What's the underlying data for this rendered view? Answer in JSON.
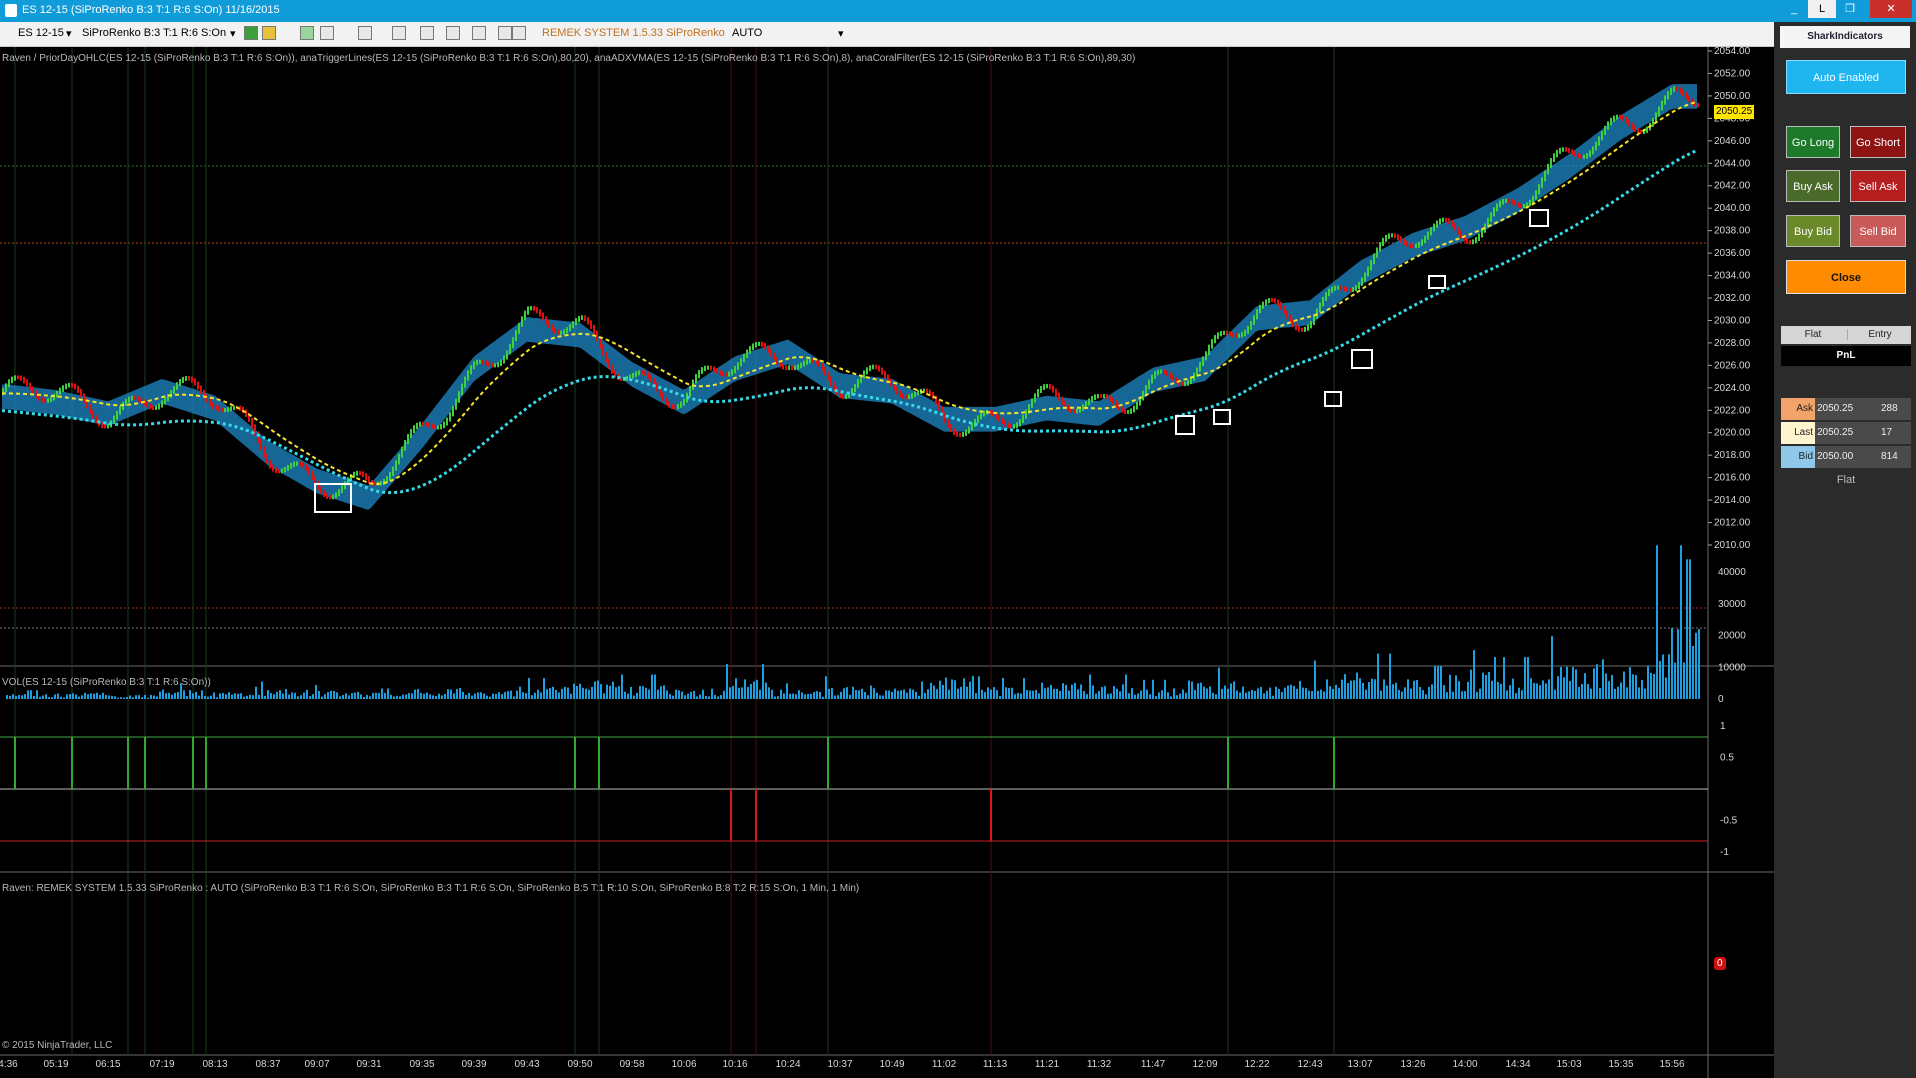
{
  "window": {
    "title": "ES 12-15 (SiProRenko B:3 T:1 R:6 S:On)  11/16/2015",
    "buttons": [
      "_",
      "L",
      "❐",
      "✕"
    ]
  },
  "toolbar": {
    "instrument": "ES 12-15",
    "bartype": "SiProRenko B:3 T:1 R:6 S:On",
    "system": "REMEK SYSTEM 1.5.33 SiProRenko",
    "mode": "AUTO"
  },
  "price_panel": {
    "indicators_label": "Raven / PriorDayOHLC(ES 12-15 (SiProRenko B:3 T:1 R:6 S:On)), anaTriggerLines(ES 12-15 (SiProRenko B:3 T:1 R:6 S:On),80,20), anaADXVMA(ES 12-15 (SiProRenko B:3 T:1 R:6 S:On),8), anaCoralFilter(ES 12-15 (SiProRenko B:3 T:1 R:6 S:On),89,30)",
    "y_ticks": [
      "2054.00",
      "2052.00",
      "2050.00",
      "2048.00",
      "2046.00",
      "2044.00",
      "2042.00",
      "2040.00",
      "2038.00",
      "2036.00",
      "2034.00",
      "2032.00",
      "2030.00",
      "2028.00",
      "2026.00",
      "2024.00",
      "2022.00",
      "2020.00",
      "2018.00",
      "2016.00",
      "2014.00",
      "2012.00",
      "2010.00"
    ],
    "last_price_tag": "2050.25"
  },
  "volume_panel": {
    "label": "VOL(ES 12-15 (SiProRenko B:3 T:1 R:6 S:On))",
    "y_ticks": [
      "40000",
      "30000",
      "20000",
      "10000",
      "0"
    ]
  },
  "signal_panel": {
    "label": "Raven: REMEK SYSTEM 1.5.33 SiProRenko : AUTO (SiProRenko B:3 T:1 R:6 S:On, SiProRenko B:3 T:1 R:6 S:On, SiProRenko B:5 T:1 R:10 S:On, SiProRenko B:8 T:2 R:15 S:On, 1 Min, 1 Min)",
    "y_ticks": [
      "1",
      "0.5",
      "0",
      "-0.5",
      "-1"
    ],
    "zero_tag": "0"
  },
  "copyright": "© 2015 NinjaTrader, LLC",
  "time_labels": [
    "4:36",
    "05:19",
    "06:15",
    "07:19",
    "08:13",
    "08:37",
    "09:07",
    "09:31",
    "09:35",
    "09:39",
    "09:43",
    "09:50",
    "09:58",
    "10:06",
    "10:16",
    "10:24",
    "10:37",
    "10:49",
    "11:02",
    "11:13",
    "11:21",
    "11:32",
    "11:47",
    "12:09",
    "12:22",
    "12:43",
    "13:07",
    "13:26",
    "14:00",
    "14:34",
    "15:03",
    "15:35",
    "15:56"
  ],
  "right_panel": {
    "brand": "SharkIndicators",
    "auto_label": "Auto Enabled",
    "go_long": "Go Long",
    "go_short": "Go Short",
    "buy_ask": "Buy Ask",
    "sell_ask": "Sell Ask",
    "buy_bid": "Buy Bid",
    "sell_bid": "Sell Bid",
    "close": "Close",
    "pos_header": [
      "Flat",
      "Entry"
    ],
    "pnl_label": "PnL",
    "quotes": [
      {
        "label": "Ask",
        "price": "2050.25",
        "size": "288"
      },
      {
        "label": "Last",
        "price": "2050.25",
        "size": "17"
      },
      {
        "label": "Bid",
        "price": "2050.00",
        "size": "814"
      }
    ],
    "status": "Flat"
  },
  "colors": {
    "bull_brick": "#3fcf3f",
    "bear_brick": "#e01010",
    "coral": "#35d9e8",
    "adxvma": "#f5e52a",
    "ribbon_up": "#1e88c8",
    "ribbon_down": "#8a1c1c",
    "volume": "#1ea0e0",
    "accent_orange": "#ff8c00",
    "auto_blue": "#1fb6f0"
  },
  "chart_data": [
    {
      "type": "line",
      "title": "",
      "series": [
        {
          "name": "price",
          "x": [
            "4:36",
            "05:19",
            "06:15",
            "07:19",
            "08:13",
            "08:37",
            "09:07",
            "09:31",
            "09:35",
            "09:39",
            "09:43",
            "09:50",
            "09:58",
            "10:06",
            "10:16",
            "10:24",
            "10:37",
            "10:49",
            "11:02",
            "11:13",
            "11:21",
            "11:32",
            "11:47",
            "12:09",
            "12:22",
            "12:43",
            "13:07",
            "13:26",
            "14:00",
            "14:34",
            "15:03",
            "15:35",
            "15:56"
          ],
          "values": [
            2023.5,
            2023.0,
            2022.0,
            2024.0,
            2022.5,
            2018.5,
            2016.0,
            2014.5,
            2020.0,
            2026.0,
            2029.5,
            2029.0,
            2025.5,
            2023.0,
            2026.0,
            2027.5,
            2024.5,
            2024.0,
            2021.5,
            2021.5,
            2022.5,
            2022.0,
            2025.0,
            2026.0,
            2030.5,
            2031.0,
            2034.5,
            2037.0,
            2038.5,
            2041.0,
            2044.0,
            2047.5,
            2050.25
          ]
        }
      ],
      "ylim": [
        2010,
        2054
      ],
      "grid": false
    },
    {
      "type": "bar",
      "title": "",
      "ylim": [
        0,
        45000
      ],
      "series": [
        {
          "name": "volume",
          "values": [
            2500,
            3000,
            2000,
            4500,
            3500,
            5000,
            4000,
            3000,
            5500,
            4000,
            6000,
            9000,
            7000,
            5000,
            10000,
            4500,
            6500,
            5000,
            12000,
            6000,
            8000,
            7000,
            5500,
            9000,
            6500,
            11000,
            13000,
            9500,
            14000,
            12000,
            18000,
            20000,
            44000
          ]
        }
      ]
    },
    {
      "type": "bar",
      "title": "",
      "ylim": [
        -1,
        1
      ],
      "series": [
        {
          "name": "signal",
          "x": [
            "05:19",
            "06:15",
            "07:19",
            "08:13",
            "08:20",
            "09:50",
            "09:58",
            "10:16",
            "10:20",
            "10:37",
            "11:13",
            "12:09",
            "13:07"
          ],
          "values": [
            1,
            1,
            1,
            1,
            1,
            1,
            1,
            -1,
            -1,
            1,
            -1,
            1,
            1
          ]
        }
      ]
    }
  ]
}
